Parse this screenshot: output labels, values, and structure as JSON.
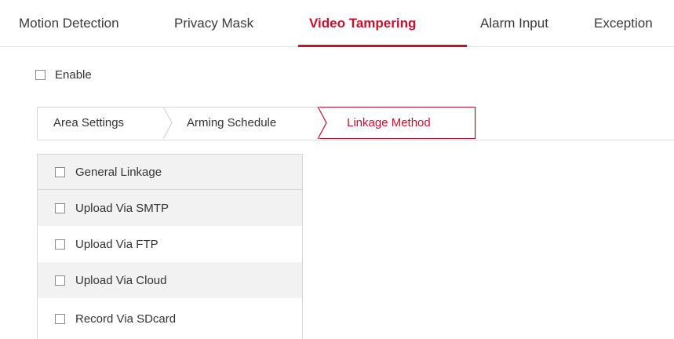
{
  "main_tabs": [
    {
      "label": "Motion Detection",
      "active": false
    },
    {
      "label": "Privacy Mask",
      "active": false
    },
    {
      "label": "Video Tampering",
      "active": true
    },
    {
      "label": "Alarm Input",
      "active": false
    },
    {
      "label": "Exception",
      "active": false
    }
  ],
  "enable": {
    "label": "Enable",
    "checked": false
  },
  "sub_tabs": [
    {
      "label": "Area Settings",
      "active": false
    },
    {
      "label": "Arming Schedule",
      "active": false
    },
    {
      "label": "Linkage Method",
      "active": true
    }
  ],
  "linkage": {
    "header": {
      "label": "General Linkage",
      "checked": false
    },
    "items": [
      {
        "label": "Upload Via SMTP",
        "checked": false
      },
      {
        "label": "Upload Via FTP",
        "checked": false
      },
      {
        "label": "Upload Via Cloud",
        "checked": false
      },
      {
        "label": "Record Via SDcard",
        "checked": false
      }
    ]
  },
  "colors": {
    "accent": "#c8102e",
    "text": "#333333",
    "row_alt": "#f2f2f2",
    "border": "#d6d6d6"
  }
}
